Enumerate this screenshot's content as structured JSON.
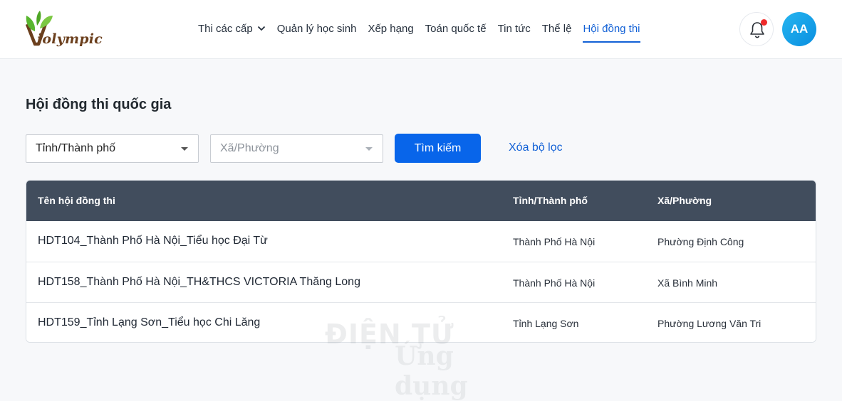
{
  "brand": {
    "logo_text": "iolympic"
  },
  "nav": {
    "items": [
      {
        "label": "Thi các cấp",
        "has_dropdown": true
      },
      {
        "label": "Quản lý học sinh"
      },
      {
        "label": "Xếp hạng"
      },
      {
        "label": "Toán quốc tế"
      },
      {
        "label": "Tin tức"
      },
      {
        "label": "Thể lệ"
      },
      {
        "label": "Hội đồng thi",
        "active": true
      }
    ]
  },
  "user": {
    "initials": "AA",
    "notification_icon": "bell-icon",
    "has_unread": true
  },
  "page": {
    "title": "Hội đồng thi quốc gia"
  },
  "filters": {
    "province": {
      "value": "Tỉnh/Thành phố"
    },
    "ward": {
      "placeholder": "Xã/Phường",
      "disabled": true
    },
    "search_label": "Tìm kiếm",
    "clear_label": "Xóa bộ lọc"
  },
  "table": {
    "headers": [
      "Tên hội đồng thi",
      "Tỉnh/Thành phố",
      "Xã/Phường"
    ],
    "rows": [
      [
        "HDT104_Thành Phố Hà Nội_Tiểu học Đại Từ",
        "Thành Phố Hà Nội",
        "Phường Định Công"
      ],
      [
        "HDT158_Thành Phố Hà Nội_TH&THCS VICTORIA Thăng Long",
        "Thành Phố Hà Nội",
        "Xã Bình Minh"
      ],
      [
        "HDT159_Tỉnh Lạng Sơn_Tiểu học Chi Lăng",
        "Tỉnh Lạng Sơn",
        "Phường Lương Văn Tri"
      ]
    ]
  },
  "watermark": {
    "line1": "ĐIỆN TỬ",
    "line2": "Ứng dụng"
  },
  "colors": {
    "primary": "#0865ea",
    "header_row": "#414d5d",
    "active_nav": "#1261d6",
    "notification_dot": "#ee2a2a"
  }
}
